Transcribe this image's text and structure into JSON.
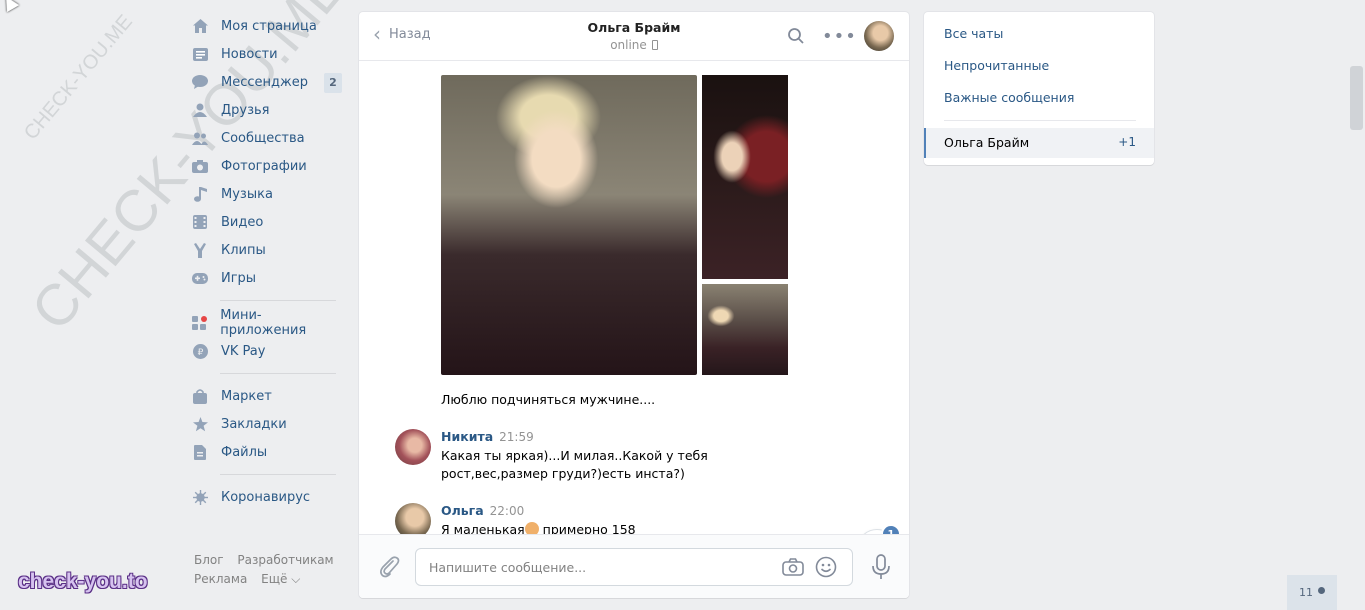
{
  "watermark": {
    "large": "CHECK-YOU.ME",
    "small": "CHECK-YOU.ME",
    "brand": "check-you.to"
  },
  "nav": {
    "items": [
      {
        "label": "Моя страница",
        "icon": "home-icon"
      },
      {
        "label": "Новости",
        "icon": "news-icon"
      },
      {
        "label": "Мессенджер",
        "icon": "messenger-icon",
        "badge": "2"
      },
      {
        "label": "Друзья",
        "icon": "friends-icon"
      },
      {
        "label": "Сообщества",
        "icon": "groups-icon"
      },
      {
        "label": "Фотографии",
        "icon": "camera-icon"
      },
      {
        "label": "Музыка",
        "icon": "music-icon"
      },
      {
        "label": "Видео",
        "icon": "video-icon"
      },
      {
        "label": "Клипы",
        "icon": "clips-icon"
      },
      {
        "label": "Игры",
        "icon": "games-icon"
      }
    ],
    "apps": [
      {
        "label": "Мини-приложения",
        "icon": "apps-icon"
      },
      {
        "label": "VK Pay",
        "icon": "vkpay-icon"
      }
    ],
    "shop": [
      {
        "label": "Маркет",
        "icon": "market-icon"
      },
      {
        "label": "Закладки",
        "icon": "star-icon"
      },
      {
        "label": "Файлы",
        "icon": "file-icon"
      }
    ],
    "extra": [
      {
        "label": "Коронавирус",
        "icon": "virus-icon"
      }
    ],
    "footer": [
      "Блог",
      "Разработчикам",
      "Реклама",
      "Ещё ⌵"
    ]
  },
  "chat": {
    "back_label": "Назад",
    "peer_name": "Ольга Брайм",
    "peer_status": "online",
    "caption": "Люблю подчиняться мужчине....",
    "messages": [
      {
        "author": "Никита",
        "time": "21:59",
        "text": "Какая ты яркая)...И милая..Какой у тебя рост,вес,размер груди?)есть инста?)"
      },
      {
        "author": "Ольга",
        "time": "22:00",
        "text_before": "Я маленькая",
        "text_after": " примерно 158"
      }
    ],
    "unread_badge": "1",
    "composer_placeholder": "Напишите сообщение..."
  },
  "right_panel": {
    "filters": [
      "Все чаты",
      "Непрочитанные",
      "Важные сообщения"
    ],
    "active_chat": {
      "name": "Ольга Брайм",
      "count": "+1"
    }
  },
  "online_widget": {
    "count": "11"
  },
  "colors": {
    "accent": "#2a5885",
    "badge_bg": "#5181b8",
    "page_bg": "#edeef0"
  }
}
